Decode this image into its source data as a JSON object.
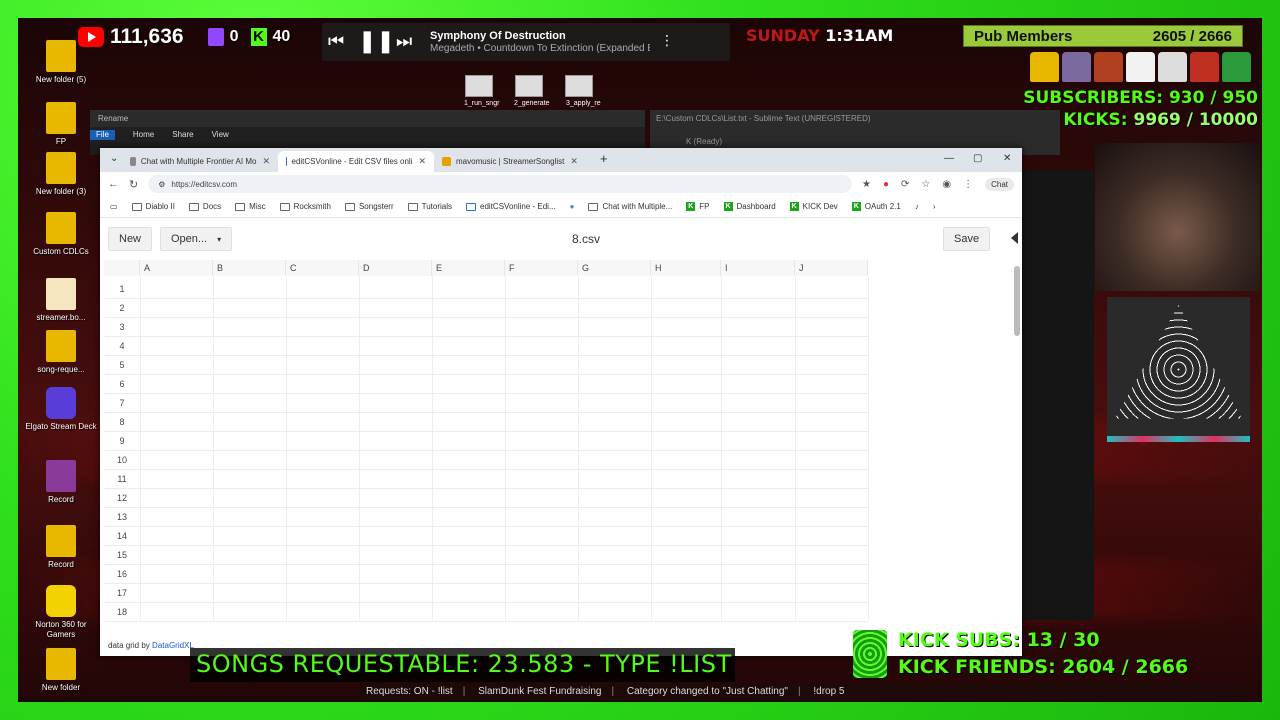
{
  "overlay": {
    "youtube_count": "111,636",
    "twitch_count": "0",
    "kick_count": "40",
    "now_playing": {
      "title": "Symphony Of Destruction",
      "artist": "Megadeth • Countdown To Extinction (Expanded E"
    },
    "day": "SUNDAY",
    "time": "1:31AM",
    "pub_members": {
      "label": "Pub Members",
      "value": "2605 / 2666"
    },
    "subscribers": {
      "label": "SUBSCRIBERS:",
      "value": "930 / 950"
    },
    "kicks": {
      "label": "KICKS:",
      "value": "9969 / 10000"
    },
    "songs_requestable": "SONGS REQUESTABLE: 23.583 - TYPE !LIST",
    "kick_subs": "KICK SUBS: 13 / 30",
    "kick_friends": "KICK FRIENDS: 2604 / 2666",
    "ticker": [
      "Requests: ON - !list",
      "SlamDunk Fest Fundraising",
      "Category changed to \"Just Chatting\"",
      "!drop 5"
    ]
  },
  "desktop_icons": [
    {
      "label": "New folder (5)"
    },
    {
      "label": "FP"
    },
    {
      "label": "New folder (3)"
    },
    {
      "label": "Custom CDLCs"
    },
    {
      "label": "streamer.bo..."
    },
    {
      "label": "song-reque..."
    },
    {
      "label": "Elgato Stream Deck"
    },
    {
      "label": "Record"
    },
    {
      "label": "Record"
    },
    {
      "label": "Norton 360 for Gamers"
    },
    {
      "label": "New folder"
    }
  ],
  "explorer": {
    "title": "Rename",
    "ribbon": [
      "File",
      "Home",
      "Share",
      "View"
    ],
    "thumbs": [
      "1_run_sngr",
      "2_generate",
      "3_apply_re"
    ]
  },
  "sublime": {
    "title": "E:\\Custom CDLCs\\List.txt - Sublime Text (UNREGISTERED)",
    "status": "K (Ready)"
  },
  "browser": {
    "tabs": [
      {
        "label": "Chat with Multiple Frontier AI Mo",
        "color": "#888888"
      },
      {
        "label": "editCSVonline - Edit CSV files onli",
        "color": "#2f6fd8"
      },
      {
        "label": "mavomusic | StreamerSonglist",
        "color": "#e8a000"
      }
    ],
    "url": "https://editcsv.com",
    "chat_label": "Chat",
    "bookmarks": [
      "Diablo II",
      "Docs",
      "Misc",
      "Rocksmith",
      "Songsterr",
      "Tutorials",
      "editCSVonline - Edi...",
      "Chat with Multiple...",
      "FP",
      "Dashboard",
      "KICK Dev",
      "OAuth 2.1"
    ]
  },
  "app": {
    "new_label": "New",
    "open_label": "Open...",
    "filename": "8.csv",
    "save_label": "Save",
    "columns": [
      "A",
      "B",
      "C",
      "D",
      "E",
      "F",
      "G",
      "H",
      "I",
      "J"
    ],
    "rows": [
      "1",
      "2",
      "3",
      "4",
      "5",
      "6",
      "7",
      "8",
      "9",
      "10",
      "11",
      "12",
      "13",
      "14",
      "15",
      "16",
      "17",
      "18"
    ],
    "footer_prefix": "data grid by",
    "footer_link": "DataGridXL"
  }
}
